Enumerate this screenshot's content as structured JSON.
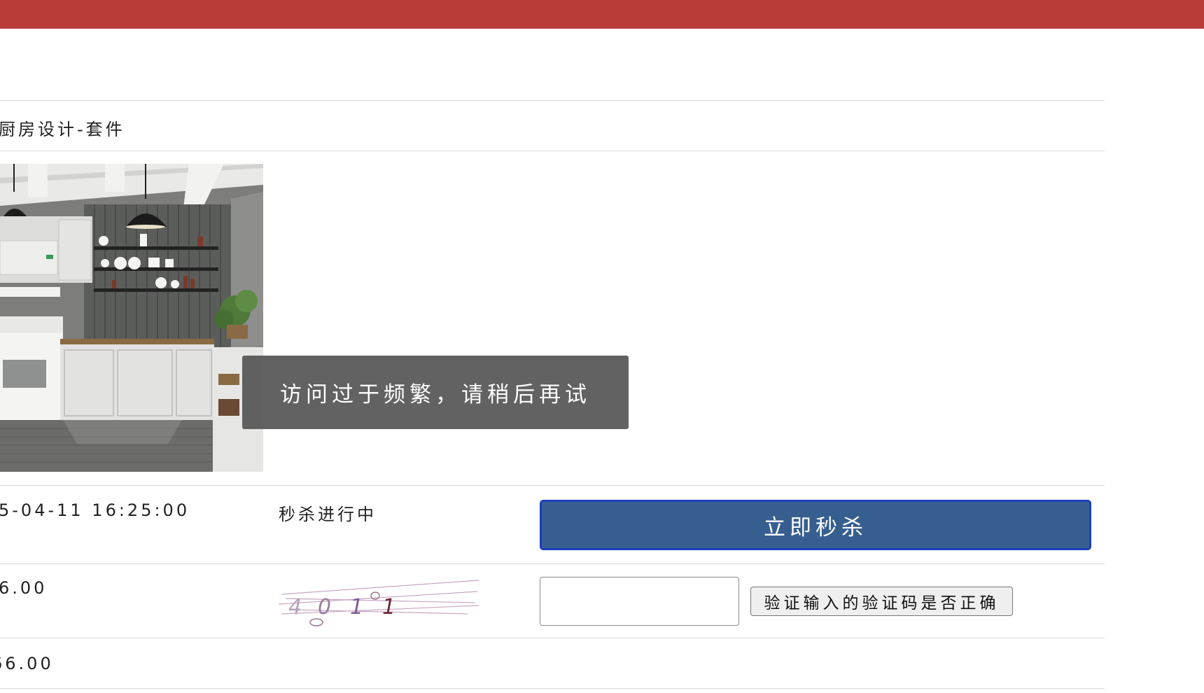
{
  "header": {
    "color": "#b93c36"
  },
  "product": {
    "name": "厨房设计-套件",
    "image_icon": "kitchen-photo"
  },
  "seckill": {
    "start_time": "5-04-11 16:25:00",
    "status": "秒杀进行中",
    "button_label": "立即秒杀",
    "button_color": "#365f8f"
  },
  "captcha": {
    "image_text": "4011",
    "input_value": "",
    "verify_label": "验证输入的验证码是否正确"
  },
  "prices": {
    "price_1": "6.00",
    "price_2": "66.00"
  },
  "toast": {
    "message": "访问过于频繁，请稍后再试"
  }
}
